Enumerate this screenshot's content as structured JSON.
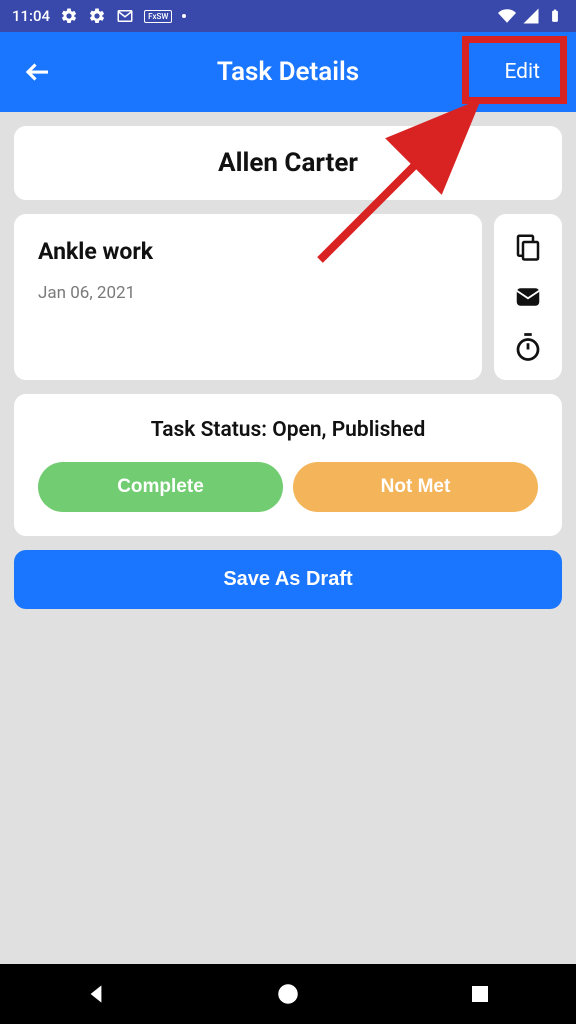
{
  "status_bar": {
    "time": "11:04",
    "badge": "FxSW"
  },
  "header": {
    "title": "Task Details",
    "edit": "Edit"
  },
  "client": {
    "name": "Allen Carter"
  },
  "task": {
    "title": "Ankle work",
    "date": "Jan 06, 2021"
  },
  "status": {
    "label": "Task Status: Open, Published",
    "complete": "Complete",
    "not_met": "Not Met"
  },
  "actions": {
    "save_draft": "Save As Draft"
  }
}
